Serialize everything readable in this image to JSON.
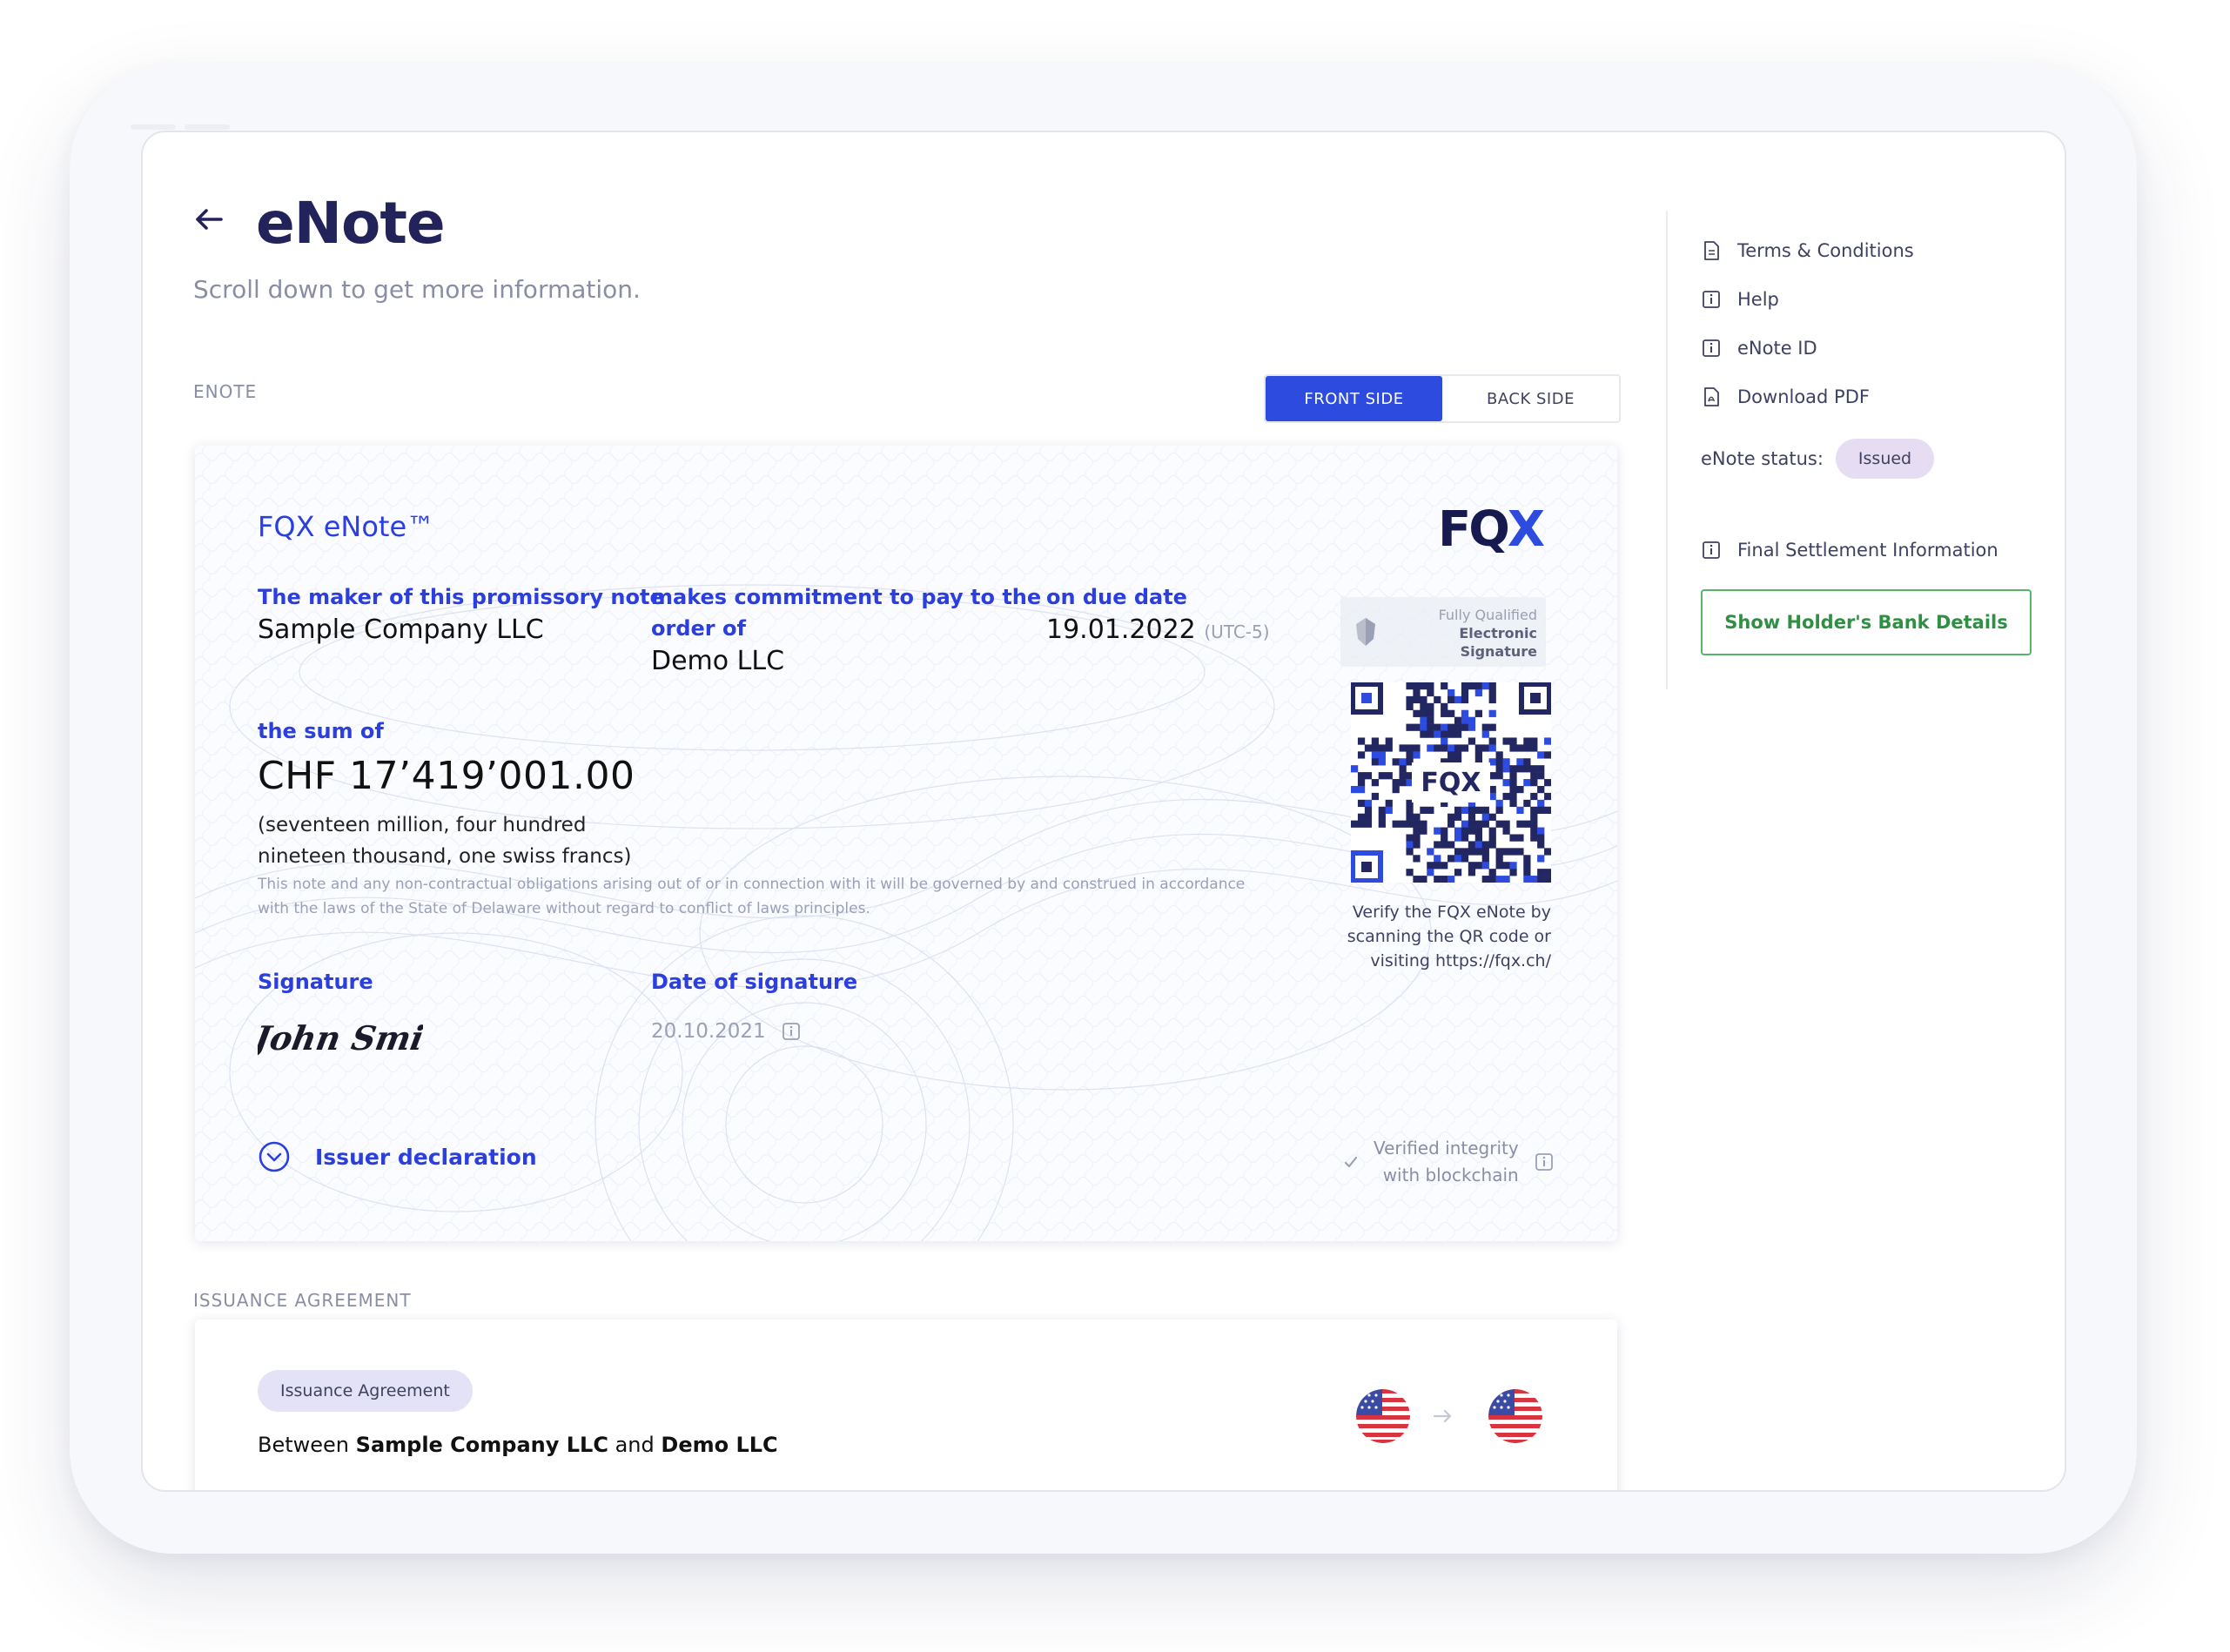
{
  "header": {
    "title": "eNote",
    "subtitle": "Scroll down to get more information."
  },
  "enote_section": {
    "label": "ENOTE",
    "toggle": {
      "front": "FRONT SIDE",
      "back": "BACK SIDE",
      "active": "front"
    }
  },
  "card": {
    "title": "FQX eNote™",
    "maker_label": "The maker of this promissory note",
    "maker_value": "Sample Company LLC",
    "commit_label_1": "makes commitment to pay to the",
    "commit_label_2": "order of",
    "commit_value": "Demo LLC",
    "due_label": "on due date",
    "due_value": "19.01.2022",
    "due_tz": "(UTC-5)",
    "sum_label": "the sum of",
    "sum_value": "CHF 17’419’001.00",
    "sum_words_1": "(seventeen million, four hundred",
    "sum_words_2": "nineteen thousand, one swiss francs)",
    "legal_1": "This note and any non-contractual obligations arising out of or in connection with it will be governed by and construed in accordance",
    "legal_2": "with the laws of the State of Delaware without regard to conflict of laws principles.",
    "signature_label": "Signature",
    "signature_name": "John Smith",
    "date_sig_label": "Date of signature",
    "date_sig_value": "20.10.2021",
    "issuer_decl": "Issuer declaration",
    "logo": "FQX",
    "fqes_1": "Fully Qualified",
    "fqes_2": "Electronic",
    "fqes_3": "Signature",
    "qr_logo": "FQX",
    "verify_1": "Verify the FQX eNote by",
    "verify_2": "scanning the QR code or",
    "verify_3": "visiting https://fqx.ch/",
    "integrity_1": "Verified integrity",
    "integrity_2": "with blockchain"
  },
  "agreement": {
    "label": "ISSUANCE AGREEMENT",
    "chip": "Issuance Agreement",
    "between_word": "Between",
    "party_a": "Sample Company LLC",
    "and_word": "and",
    "party_b": "Demo LLC"
  },
  "sidebar": {
    "links": [
      {
        "label": "Terms & Conditions",
        "icon": "document-icon"
      },
      {
        "label": "Help",
        "icon": "info-icon"
      },
      {
        "label": "eNote ID",
        "icon": "info-icon"
      },
      {
        "label": "Download PDF",
        "icon": "pdf-icon"
      }
    ],
    "status_label": "eNote status:",
    "status_value": "Issued",
    "settlement_label": "Final Settlement Information",
    "bank_button": "Show Holder's Bank Details"
  },
  "colors": {
    "accent": "#2e4bdf",
    "label_blue": "#2b3ee0",
    "title_navy": "#22235a",
    "success_green": "#58b468"
  }
}
